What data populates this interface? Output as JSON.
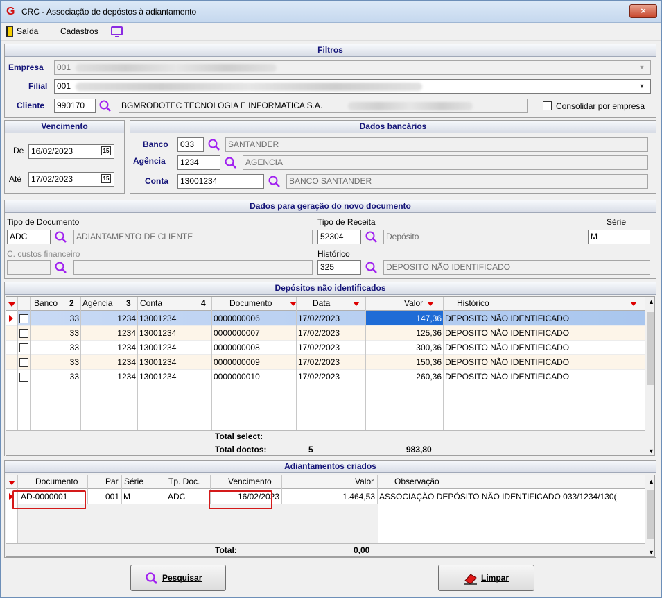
{
  "window": {
    "title": "CRC - Associação de depóstos à adiantamento",
    "close": "×"
  },
  "menu": {
    "saida": "Saída",
    "cadastros": "Cadastros"
  },
  "filtros": {
    "header": "Filtros",
    "empresa_label": "Empresa",
    "empresa_value": "001",
    "filial_label": "Filial",
    "filial_value": "001",
    "cliente_label": "Cliente",
    "cliente_value": "990170",
    "cliente_name": "BGMRODOTEC TECNOLOGIA E INFORMATICA S.A.",
    "consolidar_label": "Consolidar por empresa"
  },
  "vencimento": {
    "header": "Vencimento",
    "de_label": "De",
    "de_value": "16/02/2023",
    "ate_label": "Até",
    "ate_value": "17/02/2023",
    "cal_glyph": "15"
  },
  "bancarios": {
    "header": "Dados bancários",
    "banco_label": "Banco",
    "banco_value": "033",
    "banco_name": "SANTANDER",
    "agencia_label": "Agência",
    "agencia_value": "1234",
    "agencia_name": "AGENCIA",
    "conta_label": "Conta",
    "conta_value": "13001234",
    "conta_name": "BANCO SANTANDER"
  },
  "novo_doc": {
    "header": "Dados para geração do novo documento",
    "tipo_doc_label": "Tipo de Documento",
    "tipo_doc_value": "ADC",
    "tipo_doc_name": "ADIANTAMENTO DE CLIENTE",
    "tipo_rec_label": "Tipo de Receita",
    "tipo_rec_value": "52304",
    "tipo_rec_name": "Depósito",
    "serie_label": "Série",
    "serie_value": "M",
    "ccustos_label": "C. custos financeiro",
    "historico_label": "Histórico",
    "historico_value": "325",
    "historico_name": "DEPOSITO NÃO IDENTIFICADO"
  },
  "depositos": {
    "header": "Depósitos não identificados",
    "columns": {
      "banco": "Banco",
      "banco_sort": "2",
      "agencia": "Agência",
      "agencia_sort": "3",
      "conta": "Conta",
      "conta_sort": "4",
      "documento": "Documento",
      "data": "Data",
      "valor": "Valor",
      "historico": "Histórico"
    },
    "rows": [
      {
        "banco": "33",
        "agencia": "1234",
        "conta": "13001234",
        "documento": "0000000006",
        "data": "17/02/2023",
        "valor": "147,36",
        "historico": "DEPOSITO NÃO IDENTIFICADO"
      },
      {
        "banco": "33",
        "agencia": "1234",
        "conta": "13001234",
        "documento": "0000000007",
        "data": "17/02/2023",
        "valor": "125,36",
        "historico": "DEPOSITO NÃO IDENTIFICADO"
      },
      {
        "banco": "33",
        "agencia": "1234",
        "conta": "13001234",
        "documento": "0000000008",
        "data": "17/02/2023",
        "valor": "300,36",
        "historico": "DEPOSITO NÃO IDENTIFICADO"
      },
      {
        "banco": "33",
        "agencia": "1234",
        "conta": "13001234",
        "documento": "0000000009",
        "data": "17/02/2023",
        "valor": "150,36",
        "historico": "DEPOSITO NÃO IDENTIFICADO"
      },
      {
        "banco": "33",
        "agencia": "1234",
        "conta": "13001234",
        "documento": "0000000010",
        "data": "17/02/2023",
        "valor": "260,36",
        "historico": "DEPOSITO NÃO IDENTIFICADO"
      }
    ],
    "total_select_label": "Total select:",
    "total_doctos_label": "Total doctos:",
    "total_doctos_count": "5",
    "total_doctos_value": "983,80"
  },
  "adiantamentos": {
    "header": "Adiantamentos criados",
    "columns": {
      "documento": "Documento",
      "par": "Par",
      "serie": "Série",
      "tpdoc": "Tp. Doc.",
      "vencimento": "Vencimento",
      "valor": "Valor",
      "observacao": "Observação"
    },
    "rows": [
      {
        "documento": "AD-0000001",
        "par": "001",
        "serie": "M",
        "tpdoc": "ADC",
        "vencimento": "16/02/2023",
        "valor": "1.464,53",
        "observacao": "ASSOCIAÇÃO DEPÓSITO NÃO IDENTIFICADO 033/1234/130("
      }
    ],
    "total_label": "Total:",
    "total_value": "0,00"
  },
  "buttons": {
    "pesquisar": "Pesquisar",
    "limpar": "Limpar"
  },
  "colors": {
    "header_text": "#141478",
    "selection": "#b9d3f4",
    "highlight_box": "#d41a1a",
    "search_icon": "#a020f0"
  }
}
